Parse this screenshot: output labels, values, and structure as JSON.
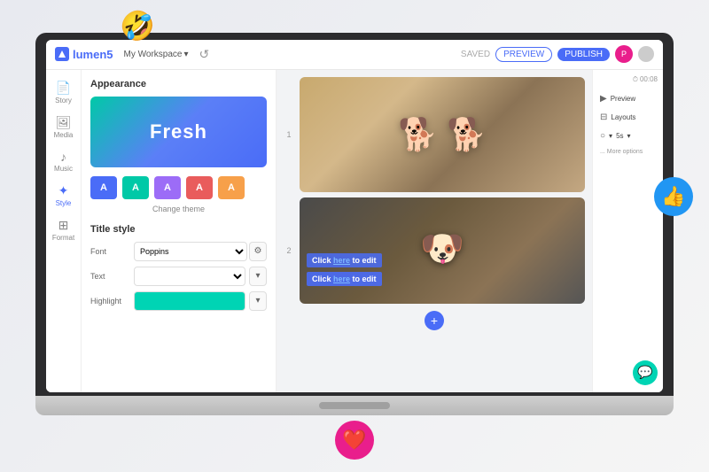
{
  "scene": {
    "emoji_laughing": "🤣",
    "emoji_thumbsup": "👍",
    "emoji_heart": "❤️"
  },
  "topbar": {
    "logo_text": "lumen5",
    "workspace_label": "My Workspace",
    "workspace_chevron": "▾",
    "undo_icon": "↺",
    "saved_text": "SAVED",
    "preview_btn": "PREVIEW",
    "publish_btn": "PUBLISH",
    "avatar_letter": "P"
  },
  "sidebar": {
    "items": [
      {
        "id": "story",
        "label": "Story",
        "icon": "📄"
      },
      {
        "id": "media",
        "label": "Media",
        "icon": "🖼"
      },
      {
        "id": "music",
        "label": "Music",
        "icon": "♪"
      },
      {
        "id": "style",
        "label": "Style",
        "icon": "✦"
      },
      {
        "id": "format",
        "label": "Format",
        "icon": "⊞"
      }
    ]
  },
  "appearance_panel": {
    "title": "Appearance",
    "theme_text": "Fresh",
    "swatches": [
      {
        "color": "#4a6cf7",
        "label": "A"
      },
      {
        "color": "#00c9a7",
        "label": "A"
      },
      {
        "color": "#9c6cf7",
        "label": "A"
      },
      {
        "color": "#e95c5c",
        "label": "A"
      },
      {
        "color": "#f7a04a",
        "label": "A"
      }
    ],
    "change_theme_btn": "Change theme",
    "title_style_label": "Title style",
    "font_label": "Font",
    "font_value": "Poppins",
    "text_label": "Text",
    "highlight_label": "Highlight"
  },
  "slides": [
    {
      "number": "1",
      "type": "dogs_running"
    },
    {
      "number": "2",
      "type": "dog_glasses",
      "overlay_line1": "Click here to edit",
      "overlay_line2": "Click here to edit"
    }
  ],
  "right_panel": {
    "timer": "00:08",
    "timer_icon": "⏱",
    "preview_btn": "Preview",
    "layouts_btn": "Layouts",
    "duration_label": "5s",
    "more_options_label": "... More options",
    "chat_icon": "💬"
  },
  "add_slide": {
    "icon": "+"
  }
}
